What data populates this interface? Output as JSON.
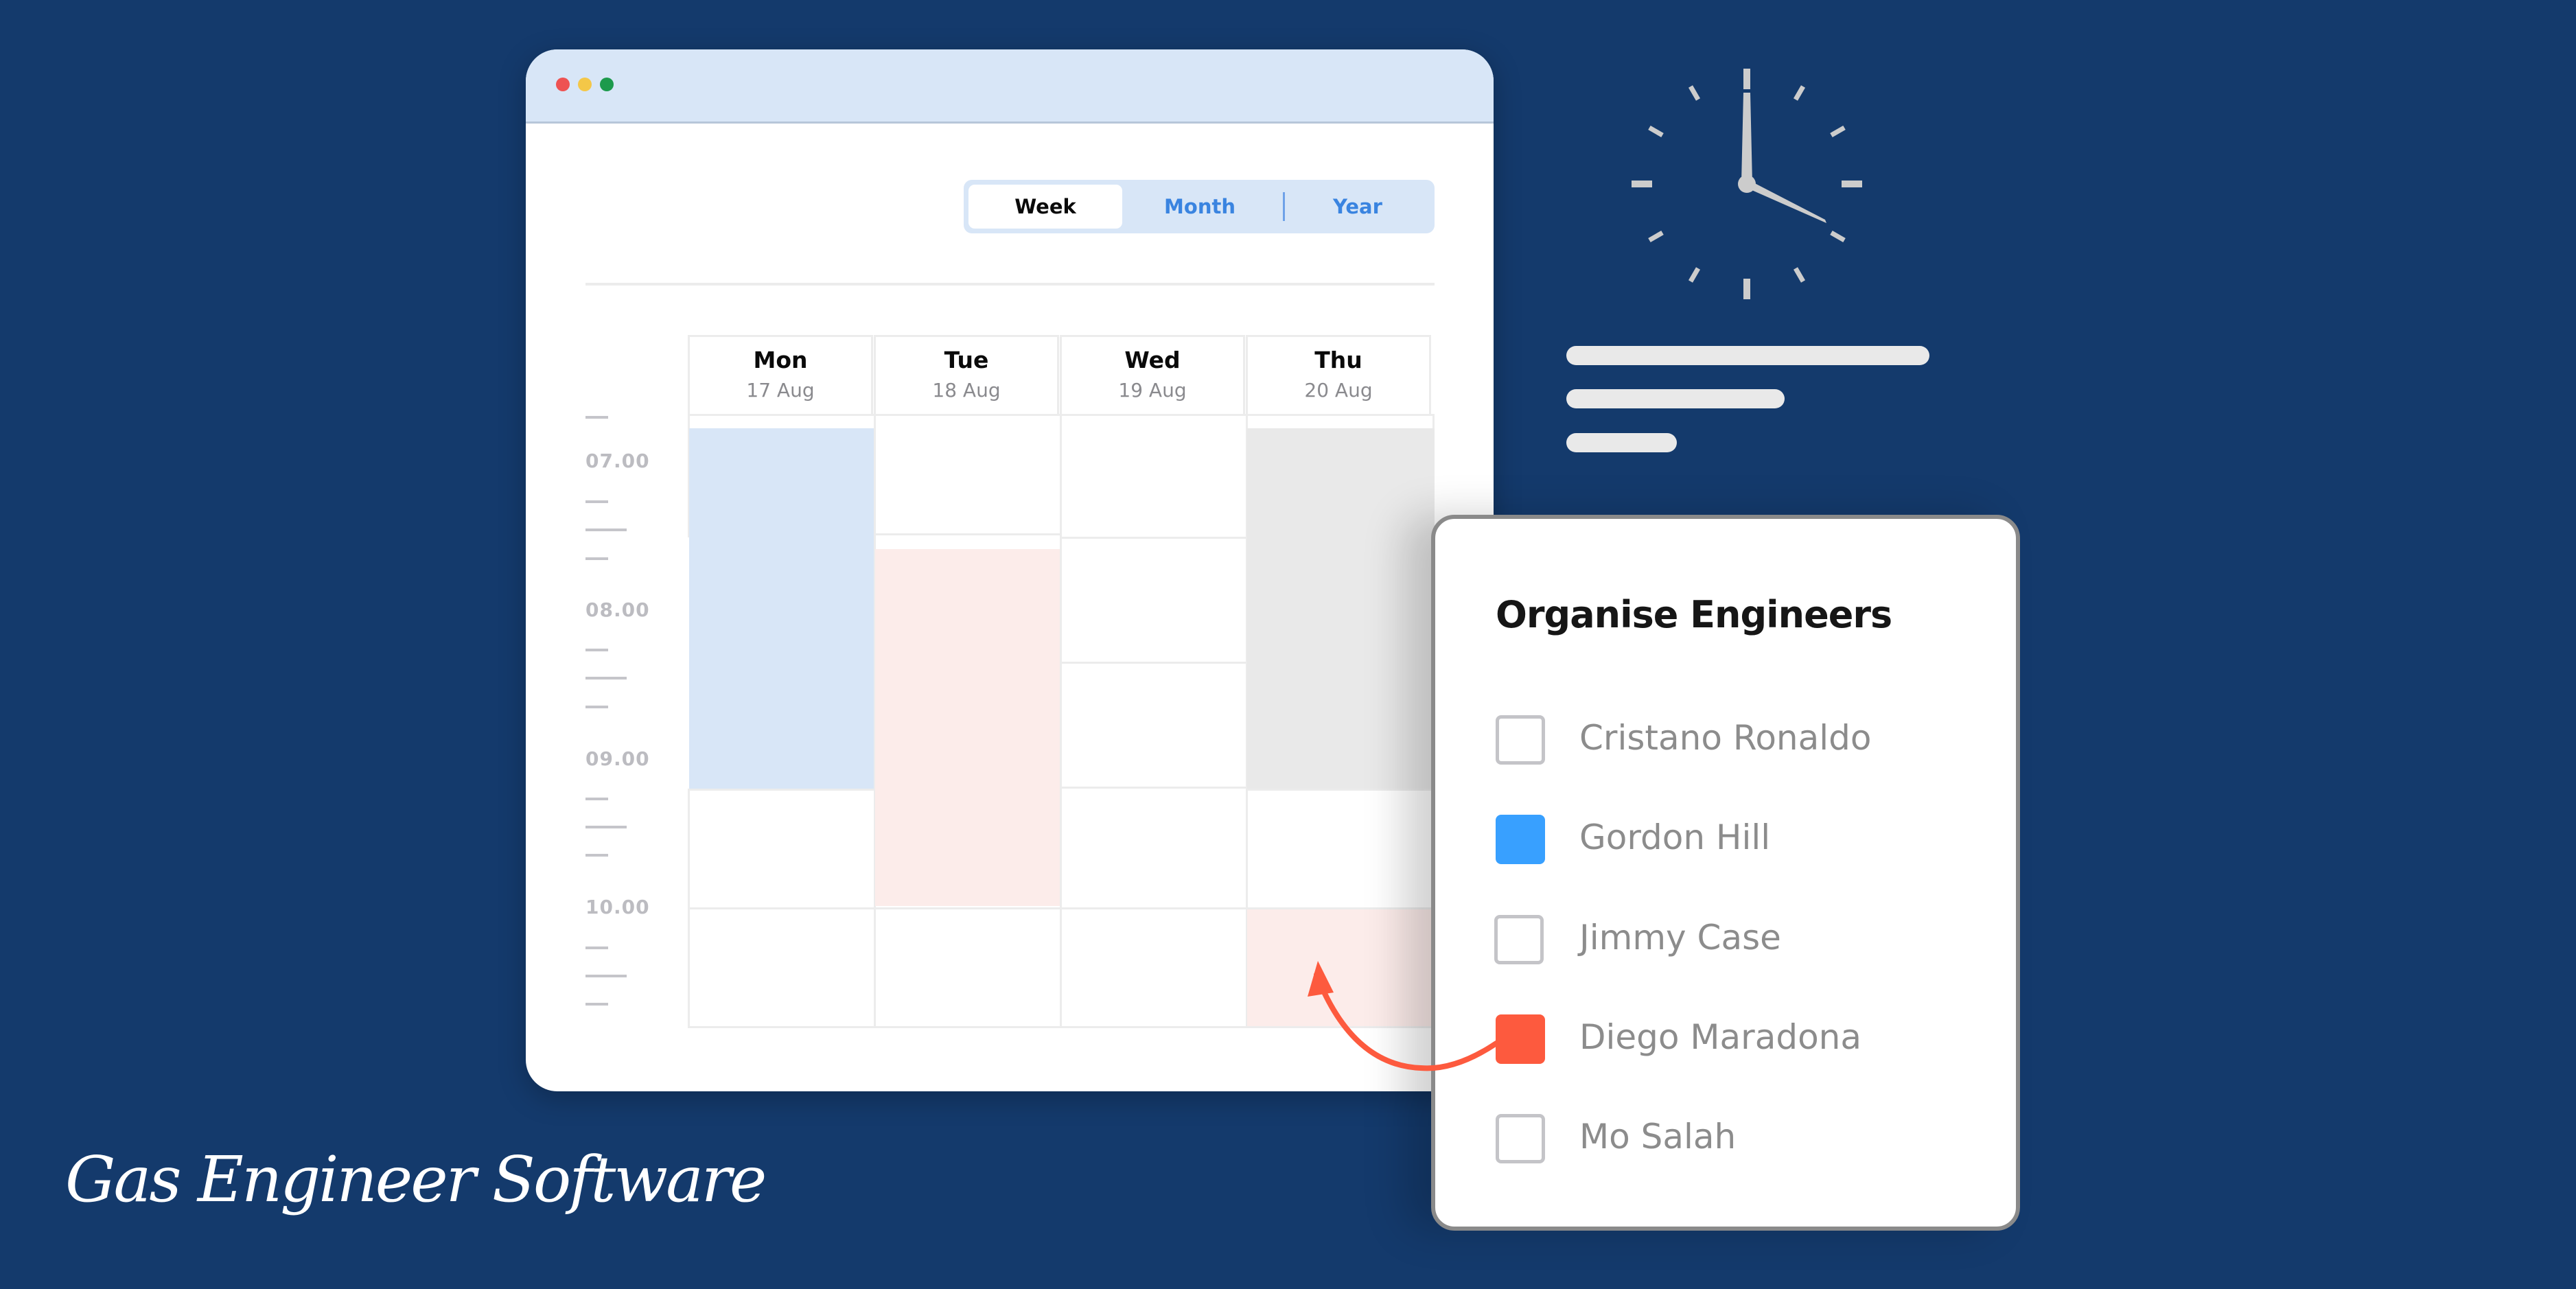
{
  "colors": {
    "background": "#143a6c",
    "titlebar": "#d8e6f7",
    "accent_blue": "#3a84e0",
    "engineer_blue": "#38a0ff",
    "engineer_red": "#fd5a3e",
    "event_blue": "#d8e6f7",
    "event_pink": "#fcecea",
    "event_grey": "#e9e9e9"
  },
  "window": {
    "controls": [
      {
        "name": "close",
        "color": "#ee5252"
      },
      {
        "name": "minimize",
        "color": "#f4c748"
      },
      {
        "name": "maximize",
        "color": "#1d9a4c"
      }
    ]
  },
  "view_toggle": {
    "options": [
      "Week",
      "Month",
      "Year"
    ],
    "selected": "Week"
  },
  "calendar": {
    "days": [
      {
        "day": "Mon",
        "date": "17 Aug"
      },
      {
        "day": "Tue",
        "date": "18 Aug"
      },
      {
        "day": "Wed",
        "date": "19 Aug"
      },
      {
        "day": "Thu",
        "date": "20 Aug"
      }
    ],
    "time_labels": [
      "07.00",
      "08.00",
      "09.00",
      "10.00"
    ]
  },
  "engineers_panel": {
    "title": "Organise Engineers",
    "engineers": [
      {
        "name": "Cristano Ronaldo",
        "checked": false,
        "color": null
      },
      {
        "name": "Gordon Hill",
        "checked": true,
        "color": "#38a0ff"
      },
      {
        "name": "Jimmy Case",
        "checked": false,
        "color": null
      },
      {
        "name": "Diego Maradona",
        "checked": true,
        "color": "#fd5a3e"
      },
      {
        "name": "Mo Salah",
        "checked": false,
        "color": null
      }
    ]
  },
  "clock": {
    "hour": 4,
    "minute": 0
  },
  "brand": {
    "name": "Gas Engineer Software"
  }
}
